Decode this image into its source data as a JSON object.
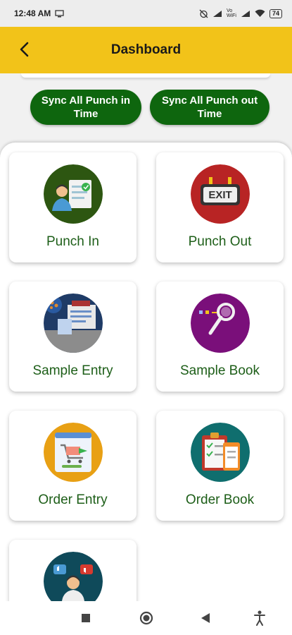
{
  "status_bar": {
    "time": "12:48 AM",
    "net_label": "Vo\nWiFi",
    "battery": "74"
  },
  "header": {
    "title": "Dashboard"
  },
  "sync_buttons": {
    "punch_in": "Sync All Punch in Time",
    "punch_out": "Sync All Punch out Time"
  },
  "cards": [
    {
      "label": "Punch In",
      "icon": "punch-in-icon"
    },
    {
      "label": "Punch Out",
      "icon": "exit-sign-icon"
    },
    {
      "label": "Sample Entry",
      "icon": "sample-entry-icon"
    },
    {
      "label": "Sample Book",
      "icon": "magnifier-icon"
    },
    {
      "label": "Order Entry",
      "icon": "cart-icon"
    },
    {
      "label": "Order Book",
      "icon": "clipboard-checklist-icon"
    },
    {
      "label": "",
      "icon": "feedback-icon"
    }
  ],
  "exit_sign_text": "EXIT",
  "colors": {
    "header": "#f2c319",
    "sync_button": "#0e660e",
    "card_label": "#1d5e18"
  }
}
